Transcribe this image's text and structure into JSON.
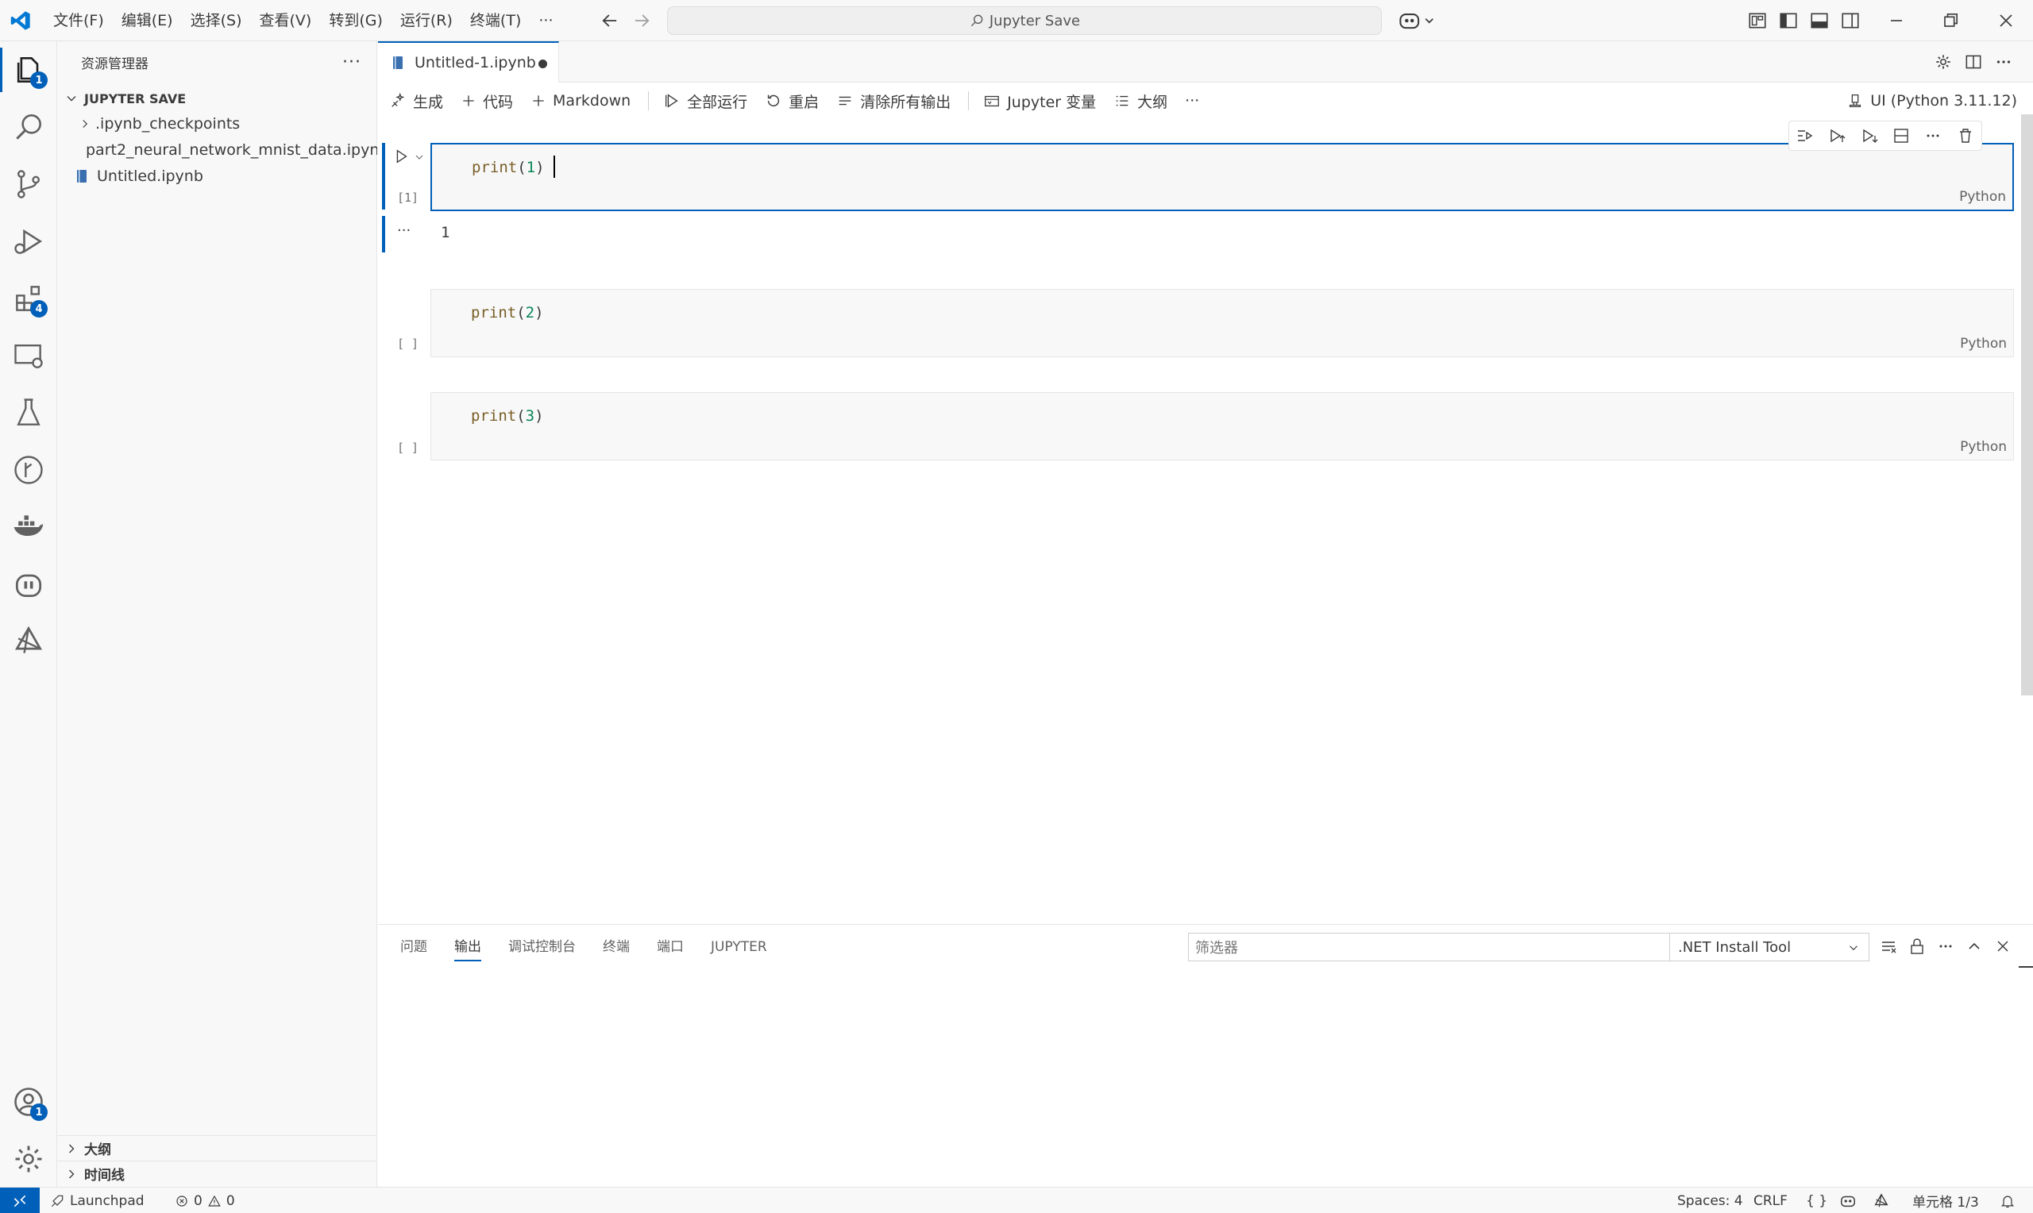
{
  "titlebar": {
    "menu": [
      "文件(F)",
      "编辑(E)",
      "选择(S)",
      "查看(V)",
      "转到(G)",
      "运行(R)",
      "终端(T)",
      "···"
    ],
    "search_text": "Jupyter Save"
  },
  "activity": {
    "explorer_badge": "1",
    "extensions_badge": "4",
    "account_badge": "1"
  },
  "sidebar": {
    "title": "资源管理器",
    "more": "···",
    "section": "JUPYTER SAVE",
    "items": [
      ".ipynb_checkpoints",
      "part2_neural_network_mnist_data.ipynb",
      "Untitled.ipynb"
    ],
    "outline": "大纲",
    "timeline": "时间线"
  },
  "editor": {
    "tab_label": "Untitled-1.ipynb",
    "toolbar": {
      "generate": "生成",
      "code": "代码",
      "markdown": "Markdown",
      "run_all": "全部运行",
      "restart": "重启",
      "clear_outputs": "清除所有输出",
      "variables": "Jupyter 变量",
      "outline": "大纲",
      "more": "···"
    },
    "kernel": "UI (Python 3.11.12)",
    "cells": [
      {
        "fn": "print",
        "arg": "1",
        "exec": "[1]",
        "lang": "Python",
        "output": "1"
      },
      {
        "fn": "print",
        "arg": "2",
        "exec": "[ ]",
        "lang": "Python"
      },
      {
        "fn": "print",
        "arg": "3",
        "exec": "[ ]",
        "lang": "Python"
      }
    ],
    "output_more": "···"
  },
  "panel": {
    "tabs": [
      "问题",
      "输出",
      "调试控制台",
      "终端",
      "端口",
      "JUPYTER"
    ],
    "filter_placeholder": "筛选器",
    "channel": ".NET Install Tool"
  },
  "statusbar": {
    "launchpad": "Launchpad",
    "errors": "0",
    "warnings": "0",
    "spaces": "Spaces: 4",
    "eol": "CRLF",
    "braces": "{ }",
    "cell_pos": "单元格 1/3"
  },
  "colors": {
    "accent": "#005fb8",
    "chrome": "#f8f8f8",
    "border": "#e5e5e5"
  }
}
